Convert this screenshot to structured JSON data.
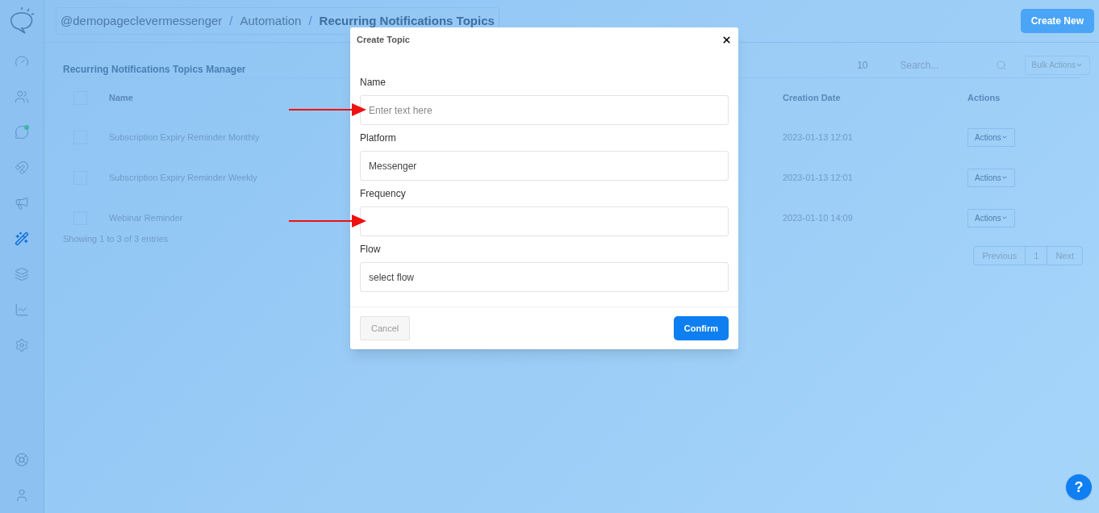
{
  "sidebar": {
    "items": [
      {
        "kind": "dashboard",
        "selected": false,
        "badge": false
      },
      {
        "kind": "users",
        "selected": false,
        "badge": false
      },
      {
        "kind": "chat",
        "selected": false,
        "badge": true
      },
      {
        "kind": "magnet",
        "selected": false,
        "badge": false
      },
      {
        "kind": "megaphone",
        "selected": false,
        "badge": false
      },
      {
        "kind": "wand",
        "selected": true,
        "badge": false
      },
      {
        "kind": "layers",
        "selected": false,
        "badge": false
      },
      {
        "kind": "chart",
        "selected": false,
        "badge": false
      },
      {
        "kind": "settings",
        "selected": false,
        "badge": false
      }
    ],
    "bottom_items": [
      {
        "kind": "lifebuoy"
      },
      {
        "kind": "user"
      }
    ]
  },
  "breadcrumb": {
    "items": [
      "@demopageclevermessenger",
      "Automation",
      "Recurring Notifications Topics"
    ],
    "separator": "/"
  },
  "create_button": "Create New",
  "panel": {
    "title": "Recurring Notifications Topics Manager",
    "page_size": "10",
    "search": {
      "placeholder": "Search..."
    },
    "bulk_actions": "Bulk Actions"
  },
  "table": {
    "header_checked": false,
    "columns": [
      "Name",
      "Creation Date",
      "Actions"
    ],
    "rows": [
      {
        "checked": false,
        "name": "Subscription Expiry Reminder Monthly",
        "date": "2023-01-13 12:01",
        "action": "Actions"
      },
      {
        "checked": false,
        "name": "Subscription Expiry Reminder Weekly",
        "date": "2023-01-13 12:01",
        "action": "Actions"
      },
      {
        "checked": false,
        "name": "Webinar Reminder",
        "date": "2023-01-10 14:09",
        "action": "Actions"
      }
    ]
  },
  "footer": {
    "info": "Showing 1 to 3 of 3 entries",
    "pagination": [
      {
        "label": "Previous",
        "selected": false
      },
      {
        "label": "1",
        "selected": false
      },
      {
        "label": "Next",
        "selected": false
      }
    ]
  },
  "modal": {
    "title": "Create Topic",
    "fields": [
      {
        "label": "Name",
        "placeholder": "Enter text here",
        "arrow": true
      },
      {
        "label": "Platform",
        "value": "Messenger",
        "arrow": false
      },
      {
        "label": "Frequency",
        "arrow": true
      },
      {
        "label": "Flow",
        "value": "select flow",
        "arrow": false
      }
    ],
    "cancel": "Cancel",
    "confirm": "Confirm"
  },
  "help": "?"
}
